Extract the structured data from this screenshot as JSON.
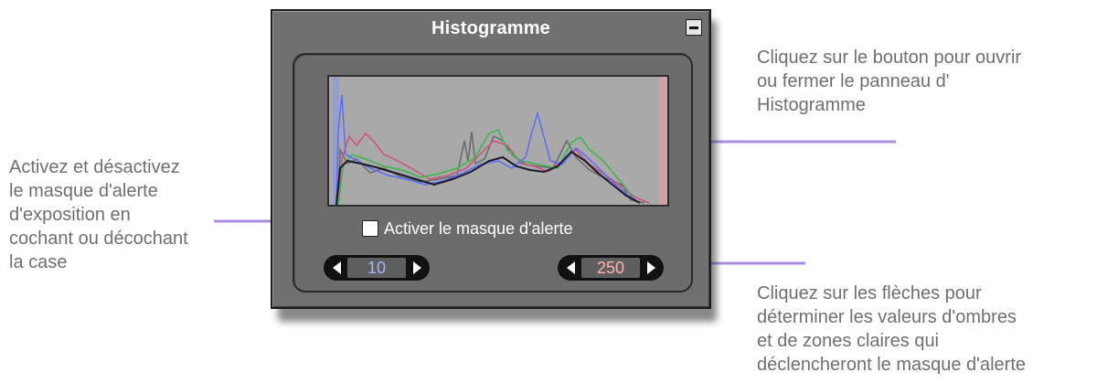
{
  "panel": {
    "title": "Histogramme",
    "alert_checkbox_label": "Activer le masque d'alerte",
    "alert_checked": false,
    "shadow_value": "10",
    "highlight_value": "250"
  },
  "callouts": {
    "top_right": "Cliquez sur le bouton pour ouvrir\nou fermer le panneau  d'\nHistogramme",
    "left": "Activez et désactivez\nle masque d'alerte\nd'exposition en\ncochant ou décochant\nla case",
    "bottom_right": "Cliquez sur les flèches pour\ndéterminer les valeurs d'ombres\net de zones claires qui\ndéclencheront le masque d'alerte"
  },
  "colors": {
    "annotation_text": "#6f6f6f",
    "arrow": "#a98ee0",
    "panel_bg": "#707070",
    "histogram_bg": "#a9a9a9",
    "shadow_value": "#a7b4ff",
    "highlight_value": "#ffb1b1"
  },
  "icons": {
    "collapse": "minus-square-icon",
    "decrease": "triangle-left-icon",
    "increase": "triangle-right-icon"
  }
}
